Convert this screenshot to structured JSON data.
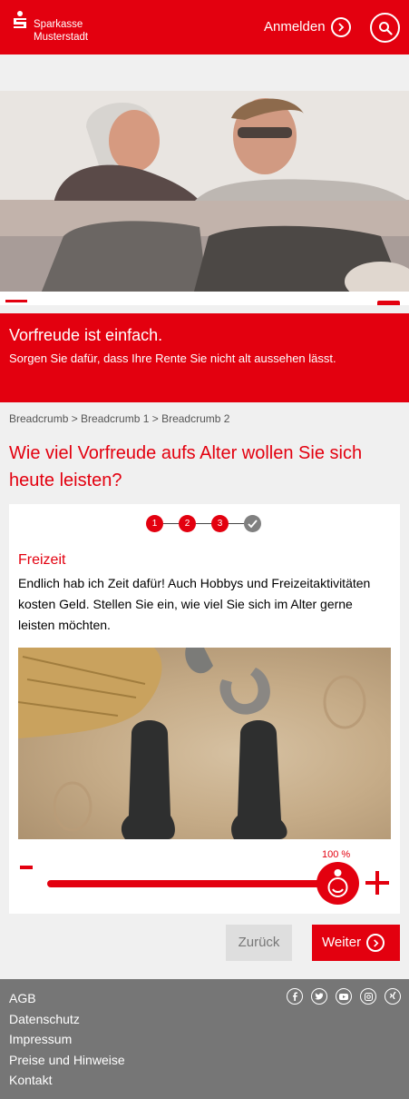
{
  "header": {
    "brand_line1": "Sparkasse",
    "brand_line2": "Musterstadt",
    "login_label": "Anmelden",
    "brand_color": "#e3000f"
  },
  "icons": {
    "search": "search-icon",
    "menu": "hamburger-menu-icon",
    "chat": "chat-bubble-icon",
    "login_arrow": "chevron-right-circle-icon"
  },
  "promo": {
    "title": "Vorfreude ist einfach.",
    "subtitle": "Sorgen Sie dafür, dass Ihre Rente Sie nicht alt aussehen lässt."
  },
  "breadcrumb": "Breadcrumb > Breadcrumb 1 > Breadcrumb 2",
  "question": "Wie viel Vorfreude aufs Alter wollen Sie sich heute leisten?",
  "stepper": {
    "steps": [
      "1",
      "2",
      "3"
    ],
    "done_icon": "checkmark-icon"
  },
  "card": {
    "title": "Freizeit",
    "text": "Endlich hab ich Zeit dafür! Auch Hobbys und Freizeitaktivitäten kosten Geld. Stellen Sie ein, wie viel Sie sich im Alter gerne leisten möchten."
  },
  "slider": {
    "value_label": "100 %",
    "value": 1.0,
    "minus_label": "-",
    "plus_label": "+"
  },
  "actions": {
    "back_label": "Zurück",
    "next_label": "Weiter"
  },
  "footer": {
    "links": [
      "AGB",
      "Datenschutz",
      "Impressum",
      "Preise und Hinweise",
      "Kontakt"
    ],
    "social": [
      "facebook-icon",
      "twitter-icon",
      "youtube-icon",
      "instagram-icon",
      "xing-icon"
    ]
  }
}
